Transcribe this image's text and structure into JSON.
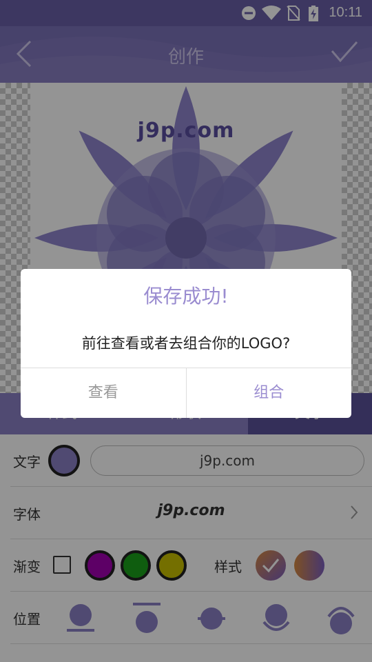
{
  "status_bar": {
    "time": "10:11"
  },
  "app_bar": {
    "title": "创作"
  },
  "canvas": {
    "logo_text": "j9p.com"
  },
  "tabs": [
    {
      "label": "样式",
      "active": false
    },
    {
      "label": "形状",
      "active": false
    },
    {
      "label": "文字",
      "active": true
    }
  ],
  "panel": {
    "text_row": {
      "label": "文字",
      "value": "j9p.com",
      "color": "#8a80c4"
    },
    "font_row": {
      "label": "字体",
      "preview": "j9p.com"
    },
    "gradient_row": {
      "label": "渐变",
      "swatches": [
        "#a000b0",
        "#1aa01a",
        "#c8c000"
      ],
      "style_label": "样式"
    },
    "position_row": {
      "label": "位置"
    }
  },
  "dialog": {
    "title": "保存成功!",
    "message": "前往查看或者去组合你的LOGO?",
    "view_label": "查看",
    "combine_label": "组合"
  },
  "colors": {
    "accent": "#7b72b8",
    "dialog_accent": "#9a8cd0"
  }
}
